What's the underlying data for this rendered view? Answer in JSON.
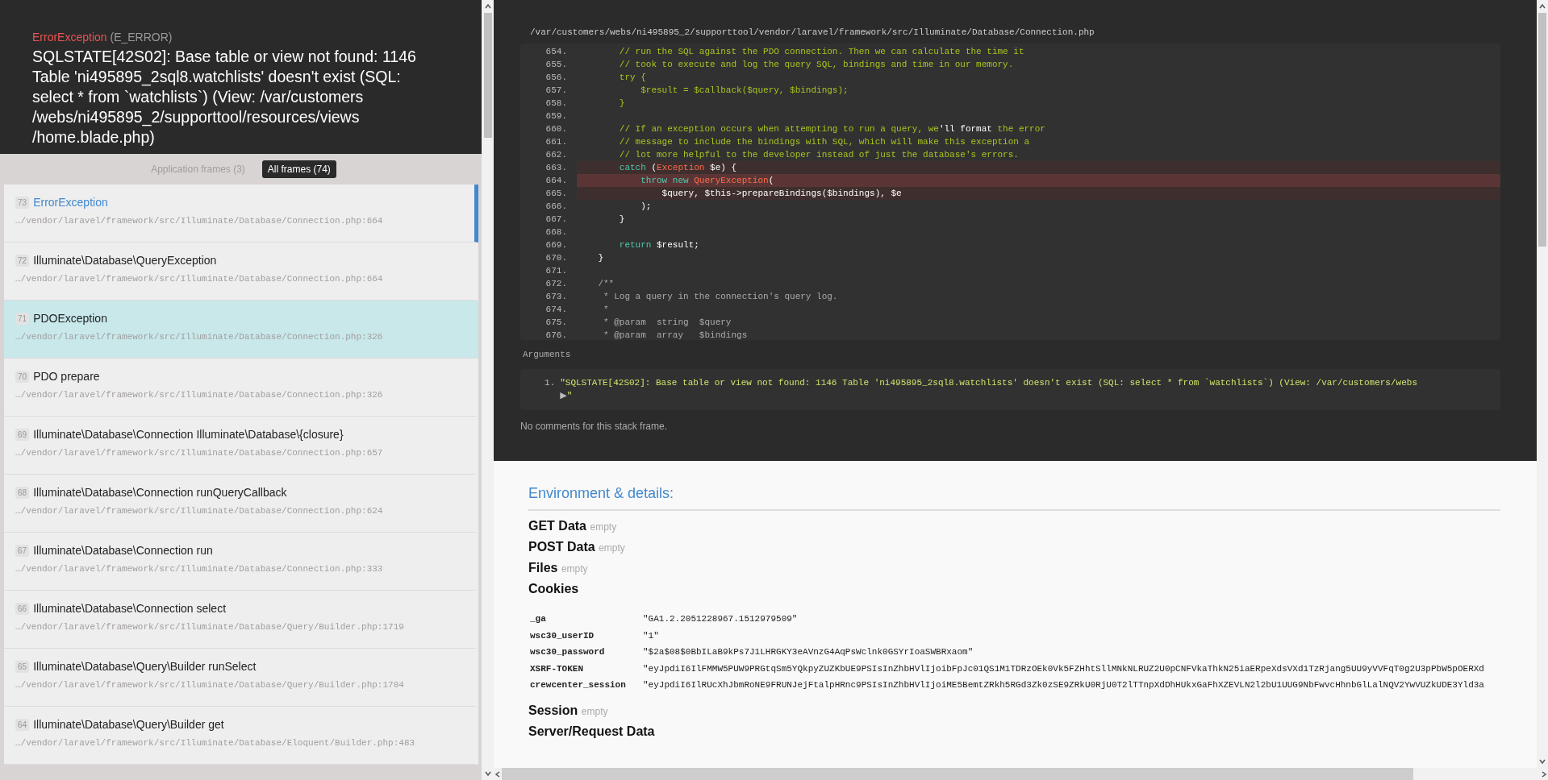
{
  "exception": {
    "class": "ErrorException",
    "code": "(E_ERROR)",
    "message": "SQLSTATE[42S02]: Base table or view not found: 1146 Table 'ni495895_2sql8.watchlists' doesn't exist (SQL: select * from `watchlists`) (View: /var/customers /webs/ni495895_2/supporttool/resources/views /home.blade.php)"
  },
  "frame_tabs": [
    {
      "label": "Application frames (3)",
      "selected": false
    },
    {
      "label": "All frames (74)",
      "selected": true
    }
  ],
  "frames": [
    {
      "number": "73",
      "title": "ErrorException",
      "file": "…/vendor/laravel/framework/src/Illuminate/Database/Connection.php:664",
      "selected": true,
      "application": false
    },
    {
      "number": "72",
      "title": "Illuminate\\Database\\QueryException",
      "file": "…/vendor/laravel/framework/src/Illuminate/Database/Connection.php:664",
      "selected": false,
      "application": false
    },
    {
      "number": "71",
      "title": "PDOException",
      "file": "…/vendor/laravel/framework/src/Illuminate/Database/Connection.php:326",
      "selected": false,
      "application": true
    },
    {
      "number": "70",
      "title": "PDO prepare",
      "file": "…/vendor/laravel/framework/src/Illuminate/Database/Connection.php:326",
      "selected": false,
      "application": false
    },
    {
      "number": "69",
      "title": "Illuminate\\Database\\Connection Illuminate\\Database\\{closure}",
      "file": "…/vendor/laravel/framework/src/Illuminate/Database/Connection.php:657",
      "selected": false,
      "application": false
    },
    {
      "number": "68",
      "title": "Illuminate\\Database\\Connection runQueryCallback",
      "file": "…/vendor/laravel/framework/src/Illuminate/Database/Connection.php:624",
      "selected": false,
      "application": false
    },
    {
      "number": "67",
      "title": "Illuminate\\Database\\Connection run",
      "file": "…/vendor/laravel/framework/src/Illuminate/Database/Connection.php:333",
      "selected": false,
      "application": false
    },
    {
      "number": "66",
      "title": "Illuminate\\Database\\Connection select",
      "file": "…/vendor/laravel/framework/src/Illuminate/Database/Query/Builder.php:1719",
      "selected": false,
      "application": false
    },
    {
      "number": "65",
      "title": "Illuminate\\Database\\Query\\Builder runSelect",
      "file": "…/vendor/laravel/framework/src/Illuminate/Database/Query/Builder.php:1704",
      "selected": false,
      "application": false
    },
    {
      "number": "64",
      "title": "Illuminate\\Database\\Query\\Builder get",
      "file": "…/vendor/laravel/framework/src/Illuminate/Database/Eloquent/Builder.php:483",
      "selected": false,
      "application": false
    }
  ],
  "code": {
    "file": "/var/customers/webs/ni495895_2/supporttool/vendor/laravel/framework/src/Illuminate/Database/Connection.php",
    "lines": [
      {
        "number": "654.",
        "highlighted": false,
        "current": false,
        "segments": [
          {
            "text": "        // run the SQL against the PDO connection. Then we can calculate the time it",
            "kind": "comment"
          }
        ]
      },
      {
        "number": "655.",
        "highlighted": false,
        "current": false,
        "segments": [
          {
            "text": "        // took to execute and log the query SQL, bindings and time in our memory.",
            "kind": "comment"
          }
        ]
      },
      {
        "number": "656.",
        "highlighted": false,
        "current": false,
        "segments": [
          {
            "text": "        try {",
            "kind": "green"
          }
        ]
      },
      {
        "number": "657.",
        "highlighted": false,
        "current": false,
        "segments": [
          {
            "text": "            $result = $callback($query, $bindings);",
            "kind": "green"
          }
        ]
      },
      {
        "number": "658.",
        "highlighted": false,
        "current": false,
        "segments": [
          {
            "text": "        }",
            "kind": "green"
          }
        ]
      },
      {
        "number": "659.",
        "highlighted": false,
        "current": false
      },
      {
        "number": "660.",
        "highlighted": false,
        "current": false,
        "segments": [
          {
            "text": "        // If an exception occurs when attempting to run a query, we",
            "kind": "comment"
          },
          {
            "text": "'ll format",
            "kind": "plain"
          },
          {
            "text": " the error",
            "kind": "comment"
          }
        ]
      },
      {
        "number": "661.",
        "highlighted": false,
        "current": false,
        "segments": [
          {
            "text": "        // message to include the bindings with SQL, which will make this exception a",
            "kind": "comment"
          }
        ]
      },
      {
        "number": "662.",
        "highlighted": false,
        "current": false,
        "segments": [
          {
            "text": "        // lot more helpful to the developer instead of just the database's errors.",
            "kind": "comment"
          }
        ]
      },
      {
        "number": "663.",
        "highlighted": true,
        "current": false,
        "segments": [
          {
            "text": "        catch ",
            "kind": "keyword"
          },
          {
            "text": "(",
            "kind": "plain"
          },
          {
            "text": "Exception",
            "kind": "class"
          },
          {
            "text": " $e) {",
            "kind": "plain"
          }
        ]
      },
      {
        "number": "664.",
        "highlighted": true,
        "current": true,
        "segments": [
          {
            "text": "            throw new ",
            "kind": "keyword"
          },
          {
            "text": "QueryException",
            "kind": "class"
          },
          {
            "text": "(",
            "kind": "plain"
          }
        ]
      },
      {
        "number": "665.",
        "highlighted": true,
        "current": false,
        "segments": [
          {
            "text": "                $query, $this->prepareBindings($bindings), $e",
            "kind": "plain"
          }
        ]
      },
      {
        "number": "666.",
        "highlighted": false,
        "current": false,
        "segments": [
          {
            "text": "            );",
            "kind": "plain"
          }
        ]
      },
      {
        "number": "667.",
        "highlighted": false,
        "current": false,
        "segments": [
          {
            "text": "        }",
            "kind": "plain"
          }
        ]
      },
      {
        "number": "668.",
        "highlighted": false,
        "current": false
      },
      {
        "number": "669.",
        "highlighted": false,
        "current": false,
        "segments": [
          {
            "text": "        return",
            "kind": "keyword"
          },
          {
            "text": " $result;",
            "kind": "plain"
          }
        ]
      },
      {
        "number": "670.",
        "highlighted": false,
        "current": false,
        "segments": [
          {
            "text": "    }",
            "kind": "plain"
          }
        ]
      },
      {
        "number": "671.",
        "highlighted": false,
        "current": false
      },
      {
        "number": "672.",
        "highlighted": false,
        "current": false,
        "segments": [
          {
            "text": "    /**",
            "kind": "doc"
          }
        ]
      },
      {
        "number": "673.",
        "highlighted": false,
        "current": false,
        "segments": [
          {
            "text": "     * Log a query in the connection's query log.",
            "kind": "doc"
          }
        ]
      },
      {
        "number": "674.",
        "highlighted": false,
        "current": false,
        "segments": [
          {
            "text": "     *",
            "kind": "doc"
          }
        ]
      },
      {
        "number": "675.",
        "highlighted": false,
        "current": false,
        "segments": [
          {
            "text": "     * @param  string  $query",
            "kind": "doc"
          }
        ]
      },
      {
        "number": "676.",
        "highlighted": false,
        "current": false,
        "segments": [
          {
            "text": "     * @param  array   $bindings",
            "kind": "doc"
          }
        ]
      }
    ]
  },
  "arguments": {
    "title": "Arguments",
    "items": [
      {
        "number": "1.",
        "value": "\"SQLSTATE[42S02]: Base table or view not found: 1146 Table 'ni495895_2sql8.watchlists' doesn't exist (SQL: select * from `watchlists`) (View: /var/customers/webs",
        "toggle": "▶",
        "closing": "\""
      }
    ]
  },
  "comments": "No comments for this stack frame.",
  "details": {
    "title": "Environment & details:",
    "sections": [
      {
        "title": "GET Data",
        "empty_label": "empty"
      },
      {
        "title": "POST Data",
        "empty_label": "empty"
      },
      {
        "title": "Files",
        "empty_label": "empty"
      },
      {
        "title": "Cookies",
        "rows": [
          {
            "key": "_ga",
            "value": "\"GA1.2.2051228967.1512979509\""
          },
          {
            "key": "wsc30_userID",
            "value": "\"1\""
          },
          {
            "key": "wsc30_password",
            "value": "\"$2a$08$0BbILaB9kPs7J1LHRGKY3eAVnzG4AqPsWclnk0GSYrIoaSWBRxaom\""
          },
          {
            "key": "XSRF-TOKEN",
            "value": "\"eyJpdiI6IlFMMW5PUW9PRGtqSm5YQkpyZUZKbUE9PSIsInZhbHVlIjoibFpJc01QS1M1TDRzOEk0Vk5FZHhtSllMNkNLRUZ2U0pCNFVkaThkN25iaERpeXdsVXd1TzRjang5UU9yVVFqT0g2U3pPbW5pOERXd"
          },
          {
            "key": "crewcenter_session",
            "value": "\"eyJpdiI6IlRUcXhJbmRoNE9FRUNJejFtalpHRnc9PSIsInZhbHVlIjoiME5BemtZRkh5RGd3Zk0zSE9ZRkU0RjU0T2lTTnpXdDhHUkxGaFhXZEVLN2l2bU1UUG9NbFwvcHhnbGlLalNQV2YwVUZkUDE3Yld3a"
          }
        ]
      },
      {
        "title": "Session",
        "empty_label": "empty"
      },
      {
        "title": "Server/Request Data"
      }
    ]
  }
}
